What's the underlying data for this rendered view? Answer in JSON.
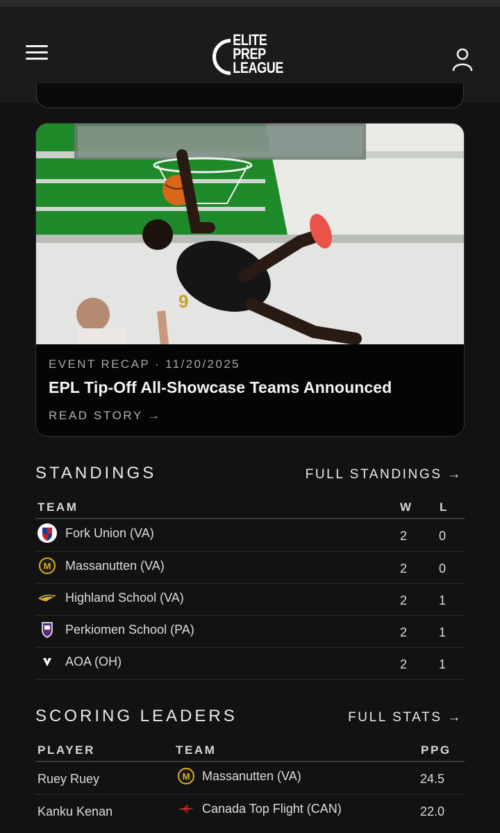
{
  "header": {
    "logo_lines": [
      "ELITE",
      "PREP",
      "LEAGUE"
    ],
    "menu_icon": "hamburger-menu-icon",
    "user_icon": "user-account-icon"
  },
  "news": {
    "category": "EVENT RECAP",
    "separator": "·",
    "date": "11/20/2025",
    "title": "EPL Tip-Off All-Showcase Teams Announced",
    "cta": "READ STORY →"
  },
  "standings": {
    "heading": "STANDINGS",
    "link": "FULL STANDINGS →",
    "columns": [
      "TEAM",
      "W",
      "L"
    ],
    "rows": [
      {
        "team": "Fork Union (VA)",
        "w": "2",
        "l": "0",
        "icon": "fork-union-shield-icon"
      },
      {
        "team": "Massanutten (VA)",
        "w": "2",
        "l": "0",
        "icon": "massanutten-m-icon"
      },
      {
        "team": "Highland School (VA)",
        "w": "2",
        "l": "1",
        "icon": "highland-hawk-icon"
      },
      {
        "team": "Perkiomen School (PA)",
        "w": "2",
        "l": "1",
        "icon": "perkiomen-crest-icon"
      },
      {
        "team": "AOA (OH)",
        "w": "2",
        "l": "1",
        "icon": "aoa-logo-icon"
      }
    ]
  },
  "scoring": {
    "heading": "SCORING LEADERS",
    "link": "FULL STATS →",
    "columns": [
      "PLAYER",
      "TEAM",
      "PPG"
    ],
    "rows": [
      {
        "player": "Ruey Ruey",
        "team": "Massanutten (VA)",
        "ppg": "24.5",
        "icon": "massanutten-m-icon"
      },
      {
        "player": "Kanku Kenan",
        "team": "Canada Top Flight (CAN)",
        "ppg": "22.0",
        "icon": "canada-top-flight-jet-icon"
      }
    ]
  },
  "colors": {
    "background": "#121212",
    "header": "#1b1b1b",
    "court_green": "#1f8a2a",
    "massanutten_gold": "#e0b020"
  }
}
